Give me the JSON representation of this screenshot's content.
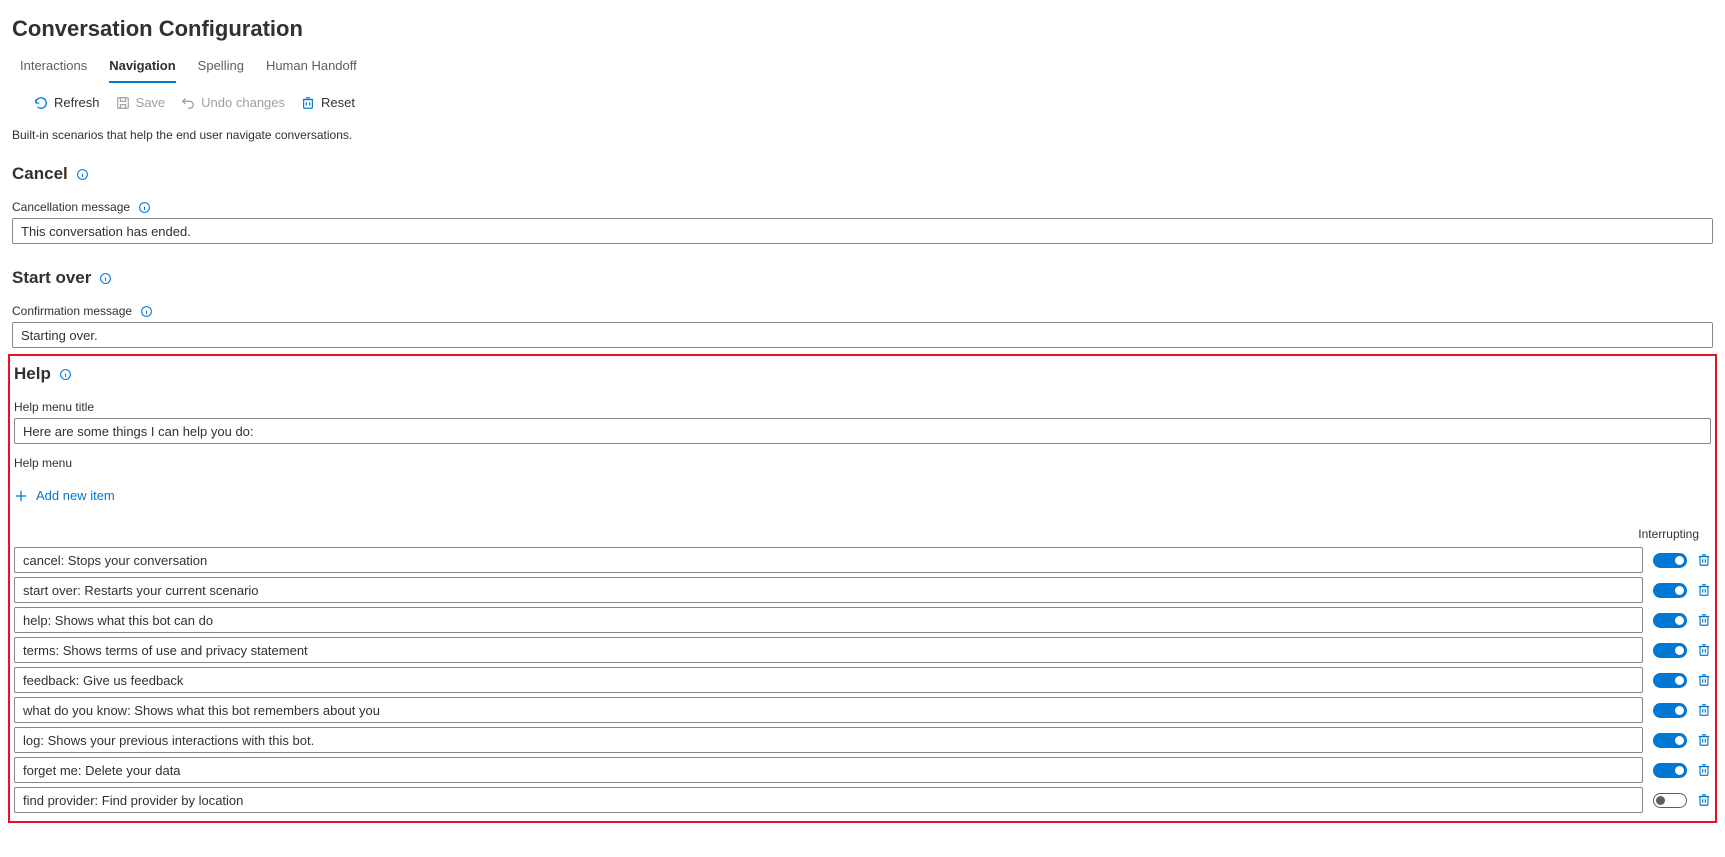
{
  "page": {
    "title": "Conversation Configuration"
  },
  "tabs": {
    "interactions": "Interactions",
    "navigation": "Navigation",
    "spelling": "Spelling",
    "human_handoff": "Human Handoff"
  },
  "toolbar": {
    "refresh": "Refresh",
    "save": "Save",
    "undo": "Undo changes",
    "reset": "Reset"
  },
  "description": "Built-in scenarios that help the end user navigate conversations.",
  "cancel": {
    "title": "Cancel",
    "field_label": "Cancellation message",
    "value": "This conversation has ended."
  },
  "startover": {
    "title": "Start over",
    "field_label": "Confirmation message",
    "value": "Starting over."
  },
  "help": {
    "title": "Help",
    "menu_title_label": "Help menu title",
    "menu_title_value": "Here are some things I can help you do:",
    "menu_label": "Help menu",
    "add_new": "Add new item",
    "interrupt_header": "Interrupting",
    "items": [
      {
        "text": "cancel: Stops your conversation",
        "on": true
      },
      {
        "text": "start over: Restarts your current scenario",
        "on": true
      },
      {
        "text": "help: Shows what this bot can do",
        "on": true
      },
      {
        "text": "terms: Shows terms of use and privacy statement",
        "on": true
      },
      {
        "text": "feedback: Give us feedback",
        "on": true
      },
      {
        "text": "what do you know: Shows what this bot remembers about you",
        "on": true
      },
      {
        "text": "log: Shows your previous interactions with this bot.",
        "on": true
      },
      {
        "text": "forget me: Delete your data",
        "on": true
      },
      {
        "text": "find provider: Find provider by location",
        "on": false
      }
    ]
  }
}
